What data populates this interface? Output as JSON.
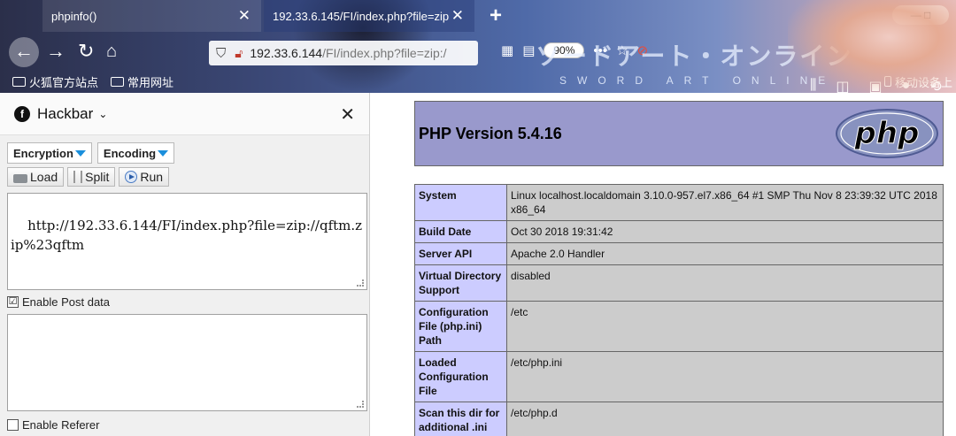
{
  "tabs": [
    {
      "title": "phpinfo()"
    },
    {
      "title": "192.33.6.145/FI/index.php?file=zip"
    }
  ],
  "window_controls": "— □",
  "navbar": {
    "url_host": "192.33.6.144",
    "url_path": "/FI/index.php?file=zip:/",
    "zoom": "90%",
    "brand_logo": "ソードアート・オンライン",
    "brand_sub": "SWORD ART ONLINE"
  },
  "bookmarks": {
    "items": [
      {
        "label": "火狐官方站点"
      },
      {
        "label": "常用网址"
      }
    ],
    "mobile": "移动设备上"
  },
  "hackbar": {
    "title": "Hackbar",
    "encryption_label": "Encryption",
    "encoding_label": "Encoding",
    "load_label": "Load",
    "split_label": "Split",
    "run_label": "Run",
    "url_value": "http://192.33.6.144/FI/index.php?file=zip://qftm.zip%23qftm",
    "enable_post_label": "Enable Post data",
    "enable_post_checked": "☑",
    "enable_referer_label": "Enable Referer"
  },
  "php": {
    "version_title": "PHP Version 5.4.16",
    "logo_text": "php",
    "rows": [
      {
        "key": "System",
        "value": "Linux localhost.localdomain 3.10.0-957.el7.x86_64 #1 SMP Thu Nov 8 23:39:32 UTC 2018 x86_64"
      },
      {
        "key": "Build Date",
        "value": "Oct 30 2018 19:31:42"
      },
      {
        "key": "Server API",
        "value": "Apache 2.0 Handler"
      },
      {
        "key": "Virtual Directory Support",
        "value": "disabled"
      },
      {
        "key": "Configuration File (php.ini) Path",
        "value": "/etc"
      },
      {
        "key": "Loaded Configuration File",
        "value": "/etc/php.ini"
      },
      {
        "key": "Scan this dir for additional .ini",
        "value": "/etc/php.d"
      }
    ]
  },
  "colors": {
    "php_header": "#9999cc",
    "php_key_cell": "#ccccff",
    "php_value_cell": "#cccccc",
    "dropdown_arrow": "#1a8fdc"
  }
}
